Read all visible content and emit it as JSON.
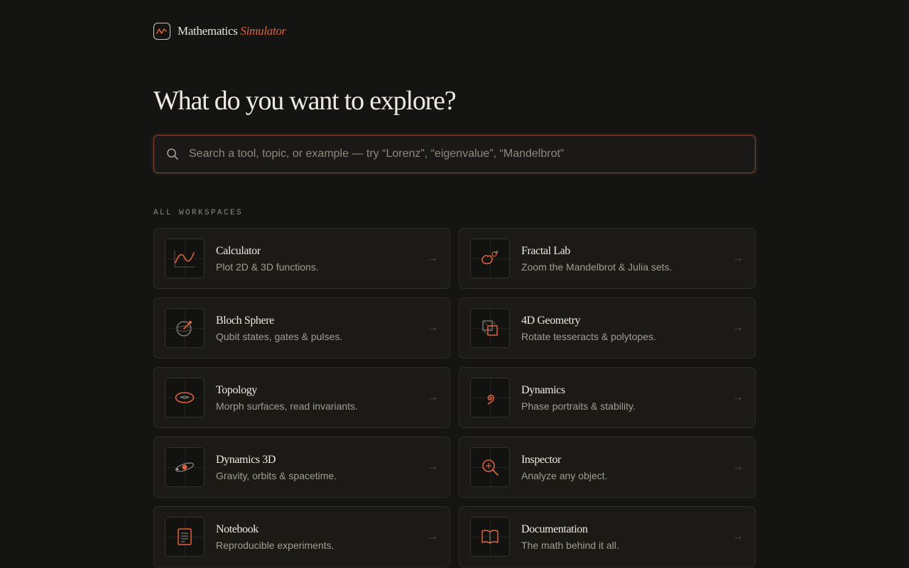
{
  "brand": {
    "name": "Mathematics",
    "accent": "Simulator"
  },
  "headline": "What do you want to explore?",
  "search": {
    "placeholder": "Search a tool, topic, or example — try “Lorenz”, “eigenvalue”, “Mandelbrot”",
    "value": ""
  },
  "section_label": "ALL WORKSPACES",
  "colors": {
    "accent": "#e0613e",
    "background": "#141412",
    "card": "#1b1a17"
  },
  "workspaces": [
    {
      "title": "Calculator",
      "desc": "Plot 2D & 3D functions.",
      "icon": "function-plot-icon"
    },
    {
      "title": "Fractal Lab",
      "desc": "Zoom the Mandelbrot & Julia sets.",
      "icon": "fractal-icon"
    },
    {
      "title": "Bloch Sphere",
      "desc": "Qubit states, gates & pulses.",
      "icon": "bloch-sphere-icon"
    },
    {
      "title": "4D Geometry",
      "desc": "Rotate tesseracts & polytopes.",
      "icon": "tesseract-icon"
    },
    {
      "title": "Topology",
      "desc": "Morph surfaces, read invariants.",
      "icon": "torus-icon"
    },
    {
      "title": "Dynamics",
      "desc": "Phase portraits & stability.",
      "icon": "spiral-icon"
    },
    {
      "title": "Dynamics 3D",
      "desc": "Gravity, orbits & spacetime.",
      "icon": "orbit-icon"
    },
    {
      "title": "Inspector",
      "desc": "Analyze any object.",
      "icon": "magnifier-icon"
    },
    {
      "title": "Notebook",
      "desc": "Reproducible experiments.",
      "icon": "notebook-icon"
    },
    {
      "title": "Documentation",
      "desc": "The math behind it all.",
      "icon": "book-icon"
    }
  ],
  "arrow": "→"
}
